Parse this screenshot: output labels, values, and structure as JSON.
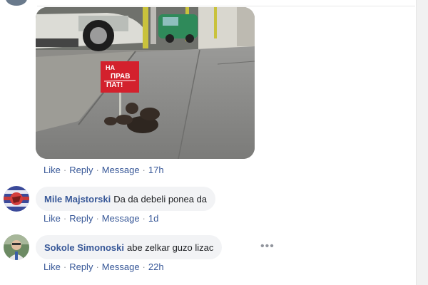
{
  "post_image": {
    "sign_line1": "НА",
    "sign_line2": "ПРАВ",
    "sign_line3": "ПАТ!",
    "sign_color": "#d3212d"
  },
  "comments": [
    {
      "author": "",
      "text": "",
      "actions": {
        "like": "Like",
        "reply": "Reply",
        "message": "Message",
        "time": "17h"
      }
    },
    {
      "author": "Mile Majstorski",
      "text": "Da da debeli ponea da",
      "actions": {
        "like": "Like",
        "reply": "Reply",
        "message": "Message",
        "time": "1d"
      }
    },
    {
      "author": "Sokole Simonoski",
      "text": "abe zelkar guzo lizac",
      "more": "•••",
      "actions": {
        "like": "Like",
        "reply": "Reply",
        "message": "Message",
        "time": "22h"
      }
    }
  ],
  "theme": {
    "link_color": "#385898",
    "bubble_bg": "#f2f3f5"
  }
}
